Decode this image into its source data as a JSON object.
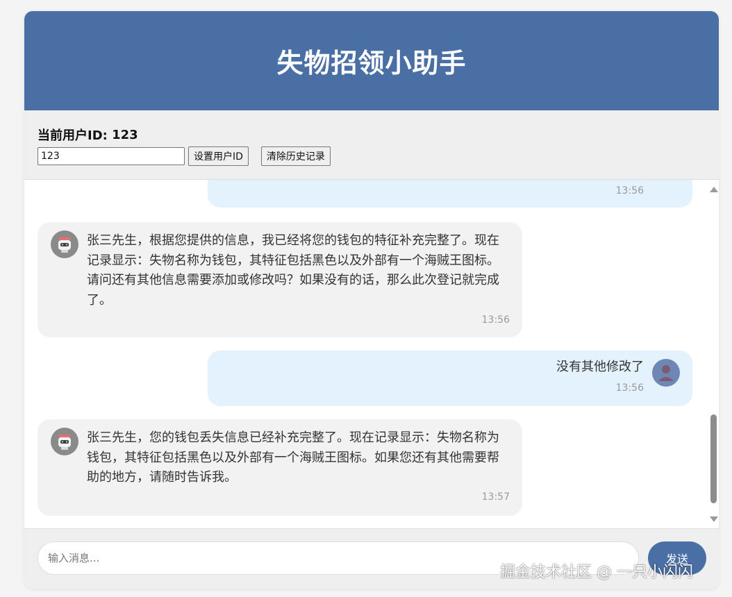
{
  "header": {
    "title": "失物招领小助手"
  },
  "user_bar": {
    "label": "当前用户ID:",
    "current_id": "123",
    "input_value": "123",
    "set_button": "设置用户ID",
    "clear_button": "清除历史记录"
  },
  "messages": [
    {
      "role": "user",
      "text": "",
      "time": "13:56"
    },
    {
      "role": "bot",
      "text": "张三先生，根据您提供的信息，我已经将您的钱包的特征补充完整了。现在记录显示：失物名称为钱包，其特征包括黑色以及外部有一个海贼王图标。请问还有其他信息需要添加或修改吗？如果没有的话，那么此次登记就完成了。",
      "time": "13:56"
    },
    {
      "role": "user",
      "text": "没有其他修改了",
      "time": "13:56"
    },
    {
      "role": "bot",
      "text": "张三先生，您的钱包丢失信息已经补充完整了。现在记录显示：失物名称为钱包，其特征包括黑色以及外部有一个海贼王图标。如果您还有其他需要帮助的地方，请随时告诉我。",
      "time": "13:57"
    }
  ],
  "composer": {
    "placeholder": "输入消息...",
    "send_label": "发送"
  },
  "watermark": "掘金技术社区 @ 一只小闪闪",
  "colors": {
    "primary": "#4a6fa5",
    "user_bubble": "#e3f2fd",
    "bot_bubble": "#f2f2f2"
  },
  "icons": {
    "user_avatar": "user-avatar-icon",
    "bot_avatar": "robot-avatar-icon"
  }
}
